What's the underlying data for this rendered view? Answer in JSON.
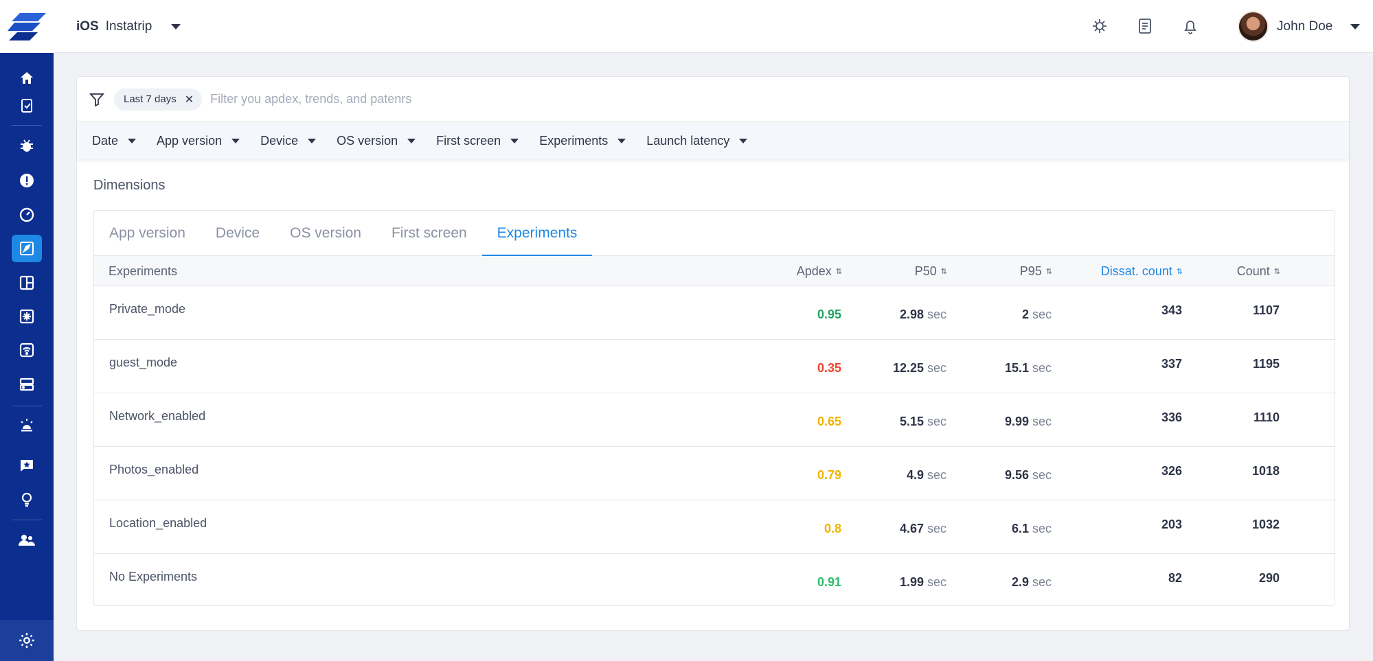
{
  "app": {
    "platform": "iOS",
    "name": "Instatrip"
  },
  "user": {
    "name": "John Doe"
  },
  "header_icons": [
    "bug-settings-icon",
    "document-icon",
    "bell-icon"
  ],
  "sidebar": {
    "items": [
      "home-icon",
      "clipboard-check-icon",
      "bug-icon",
      "alert-icon",
      "gauge-icon",
      "rocket-icon",
      "layout-icon",
      "snowflake-icon",
      "wifi-icon",
      "server-icon",
      "siren-icon",
      "star-message-icon",
      "lightbulb-icon",
      "users-icon"
    ],
    "active_index": 5,
    "bottom": "gear-icon"
  },
  "filter": {
    "chip": "Last 7 days",
    "placeholder": "Filter you apdex, trends, and patenrs",
    "dropdowns": [
      "Date",
      "App version",
      "Device",
      "OS version",
      "First screen",
      "Experiments",
      "Launch latency"
    ]
  },
  "dimensions": {
    "title": "Dimensions",
    "tabs": [
      "App version",
      "Device",
      "OS version",
      "First screen",
      "Experiments"
    ],
    "active_tab": "Experiments",
    "columns": {
      "name": "Experiments",
      "apdex": "Apdex",
      "p50": "P50",
      "p95": "P95",
      "dissat": "Dissat. count",
      "count": "Count"
    },
    "unit": "sec",
    "rows": [
      {
        "name": "Private_mode",
        "apdex": "0.95",
        "apdex_color": "#1fa463",
        "p50": "2.98",
        "p95": "2",
        "dissat": "343",
        "count": "1107"
      },
      {
        "name": "guest_mode",
        "apdex": "0.35",
        "apdex_color": "#e8452c",
        "p50": "12.25",
        "p95": "15.1",
        "dissat": "337",
        "count": "1195"
      },
      {
        "name": "Network_enabled",
        "apdex": "0.65",
        "apdex_color": "#f0b400",
        "p50": "5.15",
        "p95": "9.99",
        "dissat": "336",
        "count": "1110"
      },
      {
        "name": "Photos_enabled",
        "apdex": "0.79",
        "apdex_color": "#f0b400",
        "p50": "4.9",
        "p95": "9.56",
        "dissat": "326",
        "count": "1018"
      },
      {
        "name": "Location_enabled",
        "apdex": "0.8",
        "apdex_color": "#f0b400",
        "p50": "4.67",
        "p95": "6.1",
        "dissat": "203",
        "count": "1032"
      },
      {
        "name": "No Experiments",
        "apdex": "0.91",
        "apdex_color": "#2bbf6a",
        "p50": "1.99",
        "p95": "2.9",
        "dissat": "82",
        "count": "290"
      }
    ]
  },
  "colors": {
    "sidebar": "#0b2e8f",
    "accent": "#1e88e5"
  }
}
